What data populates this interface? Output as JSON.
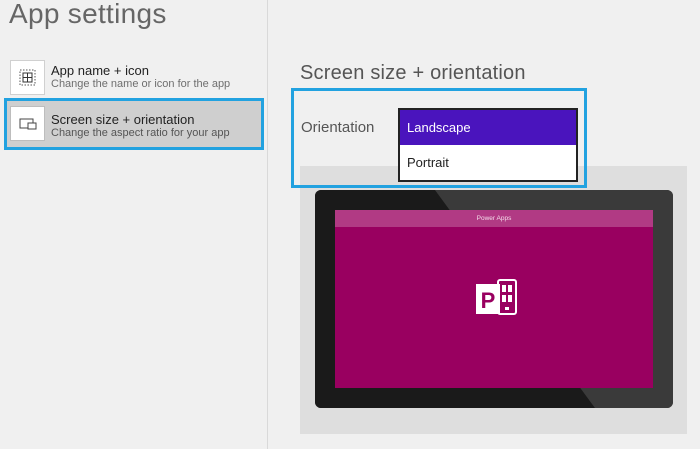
{
  "sidebar": {
    "title": "App settings",
    "items": [
      {
        "label": "App name + icon",
        "description": "Change the name or icon for the app",
        "icon": "app-grid-icon",
        "selected": false
      },
      {
        "label": "Screen size + orientation",
        "description": "Change the aspect ratio for your app",
        "icon": "screen-orientation-icon",
        "selected": true
      }
    ]
  },
  "main": {
    "heading": "Screen size + orientation",
    "orientation": {
      "label": "Orientation",
      "options": [
        "Landscape",
        "Portrait"
      ],
      "selected": "Landscape"
    },
    "preview": {
      "app_title": "Power Apps",
      "logo_icon": "powerapps-logo-icon"
    }
  },
  "colors": {
    "highlight_border": "#22a2e0",
    "selected_option": "#4a14bd",
    "app_background": "#990060",
    "app_titlebar": "#b13a84"
  }
}
